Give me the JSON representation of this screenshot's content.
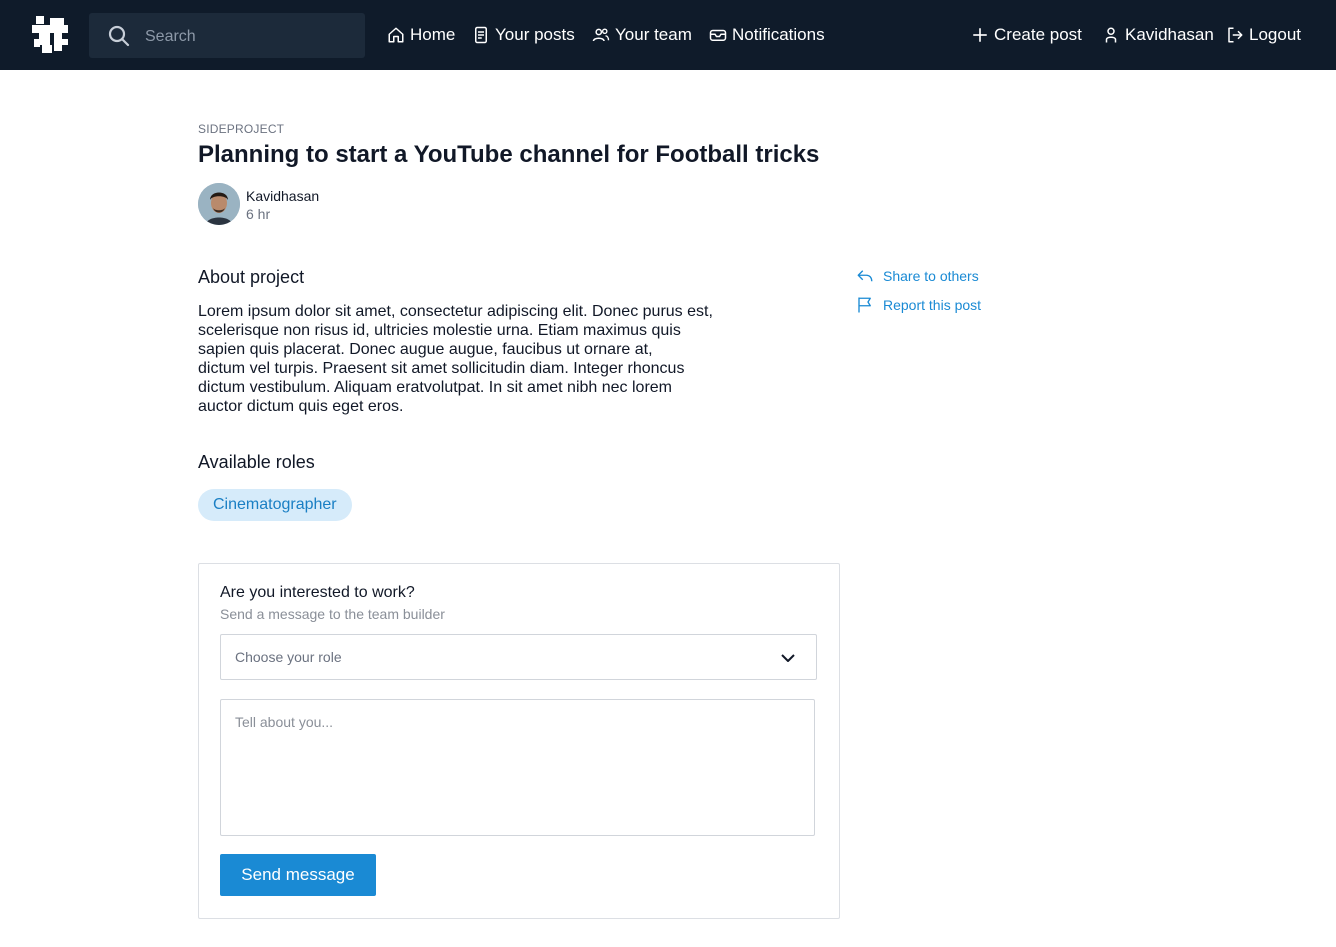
{
  "nav": {
    "search_placeholder": "Search",
    "items": [
      {
        "label": "Home",
        "icon": "home-icon"
      },
      {
        "label": "Your posts",
        "icon": "document-icon"
      },
      {
        "label": "Your team",
        "icon": "team-icon"
      },
      {
        "label": "Notifications",
        "icon": "inbox-icon"
      }
    ],
    "create_post": "Create post",
    "user_name": "Kavidhasan",
    "logout": "Logout"
  },
  "post": {
    "category": "SIDEPROJECT",
    "title": "Planning to start a YouTube channel for Football tricks",
    "author": "Kavidhasan",
    "time": "6 hr",
    "about_heading": "About project",
    "about_text": "Lorem ipsum dolor sit amet, consectetur adipiscing elit. Donec purus est,\nscelerisque non risus id, ultricies  molestie urna. Etiam maximus quis\nsapien quis placerat. Donec augue augue, faucibus ut ornare at,\ndictum vel turpis. Praesent sit amet sollicitudin diam. Integer rhoncus\ndictum vestibulum. Aliquam eratvolutpat. In sit amet nibh nec lorem\nauctor dictum quis eget eros.",
    "roles_heading": "Available roles",
    "roles": [
      "Cinematographer"
    ]
  },
  "side_actions": {
    "share": "Share to others",
    "report": "Report this post"
  },
  "apply_form": {
    "title": "Are you interested to work?",
    "subtitle": "Send a message to the team builder",
    "role_placeholder": "Choose your role",
    "message_placeholder": "Tell about you...",
    "send_label": "Send message"
  },
  "colors": {
    "navbar_bg": "#0f1b2a",
    "accent": "#1a8ad4",
    "chip_bg": "#d6ebfa"
  }
}
